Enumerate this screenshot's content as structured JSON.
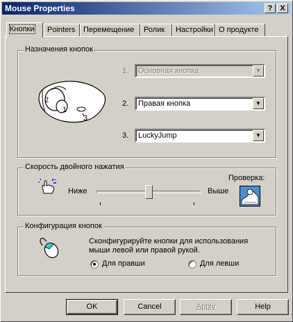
{
  "window": {
    "title": "Mouse Properties",
    "help_btn": "?",
    "close_btn": "X"
  },
  "tabs": [
    {
      "label": "Кнопки",
      "active": true
    },
    {
      "label": "Pointers"
    },
    {
      "label": "Перемещение"
    },
    {
      "label": "Ролик"
    },
    {
      "label": "Настройки"
    },
    {
      "label": "О продукте"
    }
  ],
  "assignments": {
    "title": "Назначения кнопок",
    "mouse_labels": [
      "2",
      "1",
      "3"
    ],
    "rows": [
      {
        "num": "1.",
        "value": "Основная кнопка",
        "disabled": true
      },
      {
        "num": "2.",
        "value": "Правая кнопка",
        "disabled": false
      },
      {
        "num": "3.",
        "value": "LuckyJump",
        "disabled": false
      }
    ]
  },
  "double_click": {
    "title": "Скорость двойного нажатия",
    "slow_label": "Ниже",
    "fast_label": "Выше",
    "test_label": "Проверка:",
    "speed_fraction": 0.5
  },
  "config": {
    "title": "Конфигурация кнопок",
    "description_line1": "Сконфигурируйте кнопки для использования",
    "description_line2": "мыши левой или правой рукой.",
    "right_hand": "Для правши",
    "left_hand": "Для левши",
    "selected": "right"
  },
  "buttons": {
    "ok": "OK",
    "cancel": "Cancel",
    "apply": "Apply",
    "help": "Help"
  }
}
